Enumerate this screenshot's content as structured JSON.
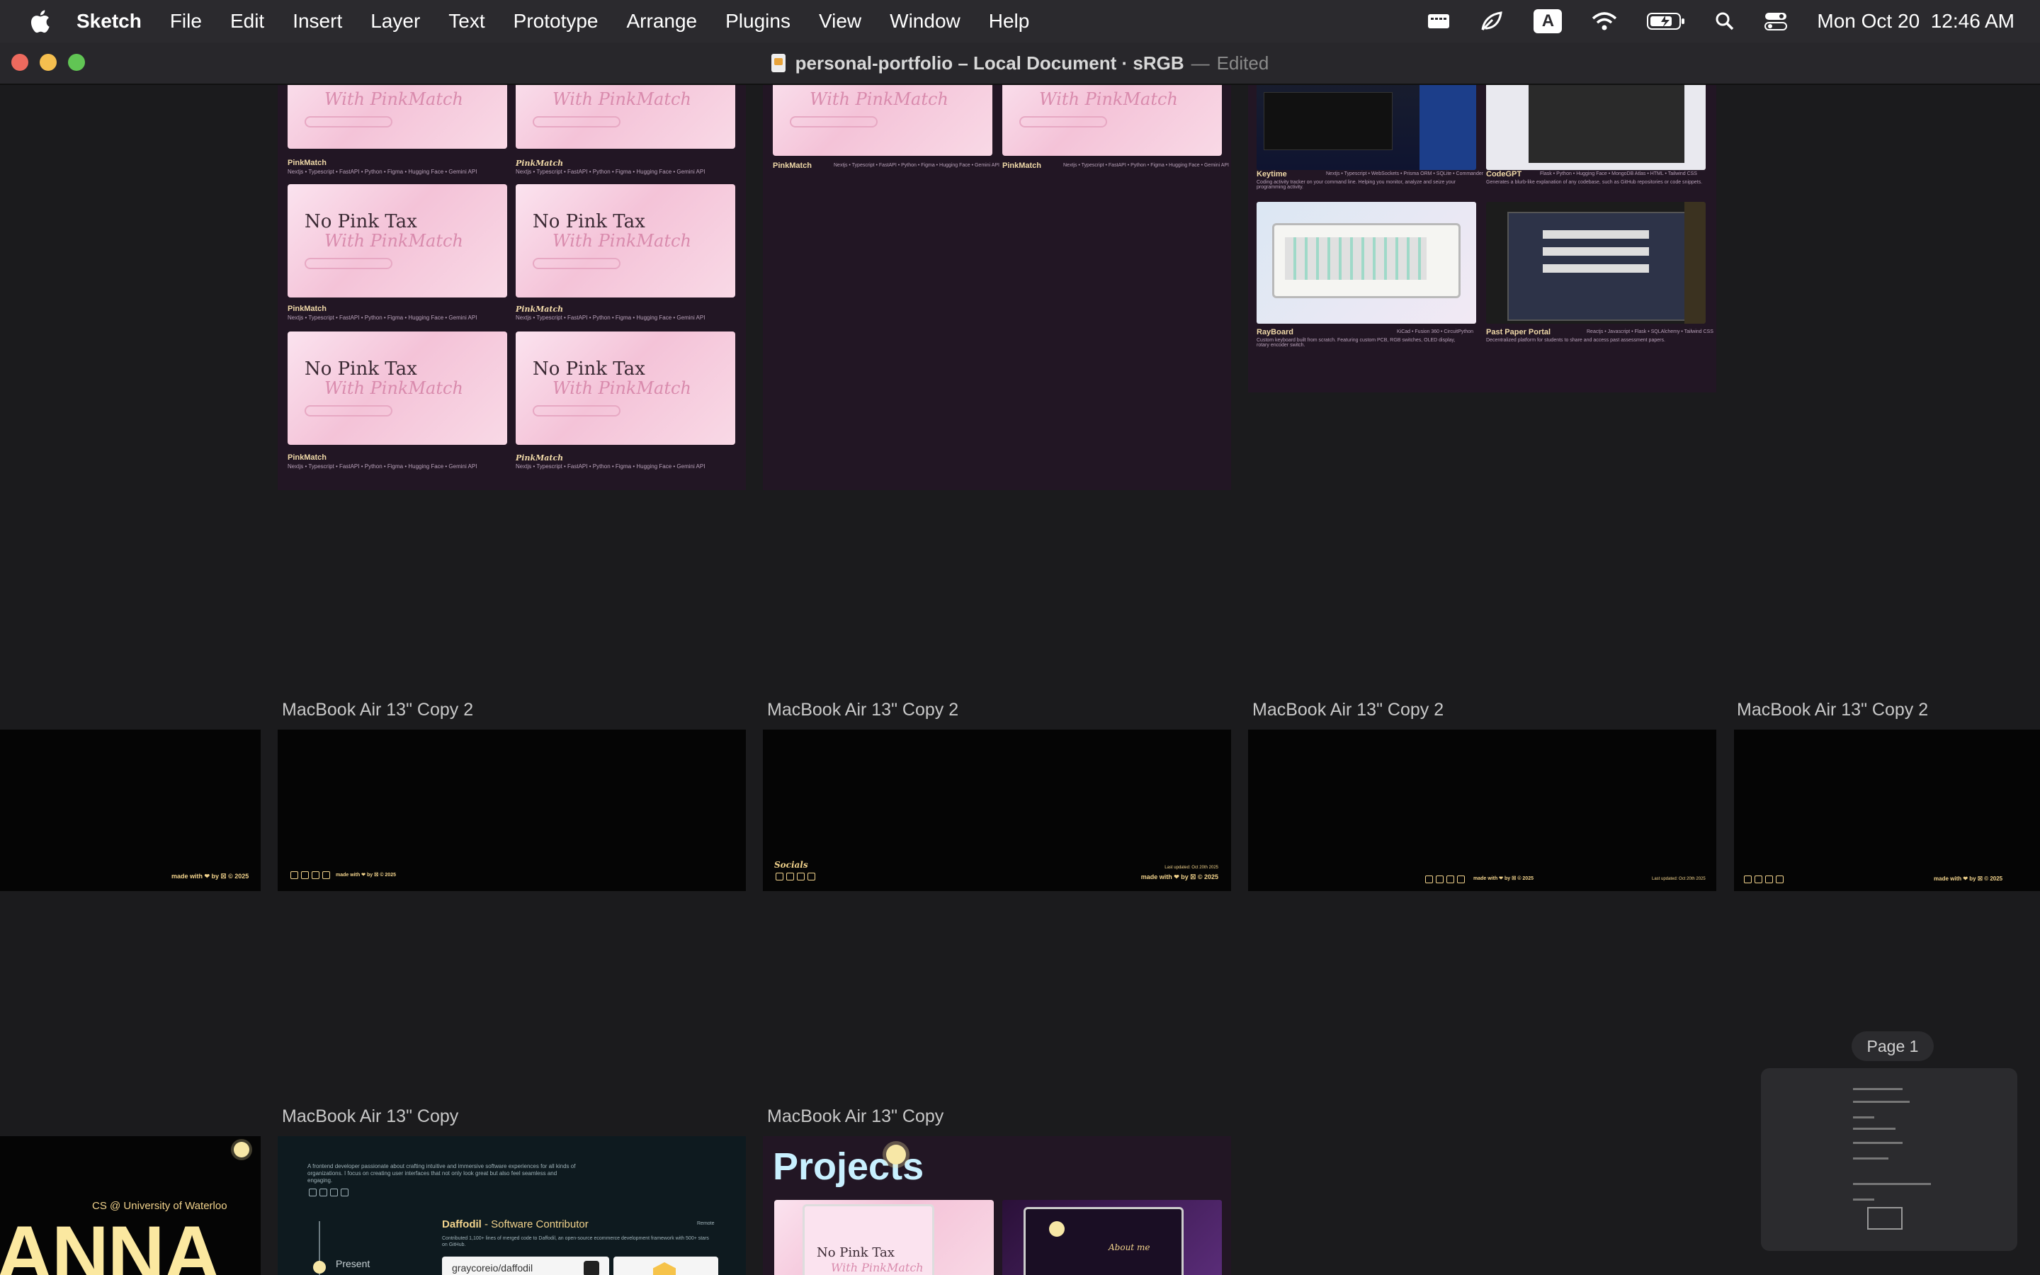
{
  "menubar": {
    "app_name": "Sketch",
    "items": [
      "File",
      "Edit",
      "Insert",
      "Layer",
      "Text",
      "Prototype",
      "Arrange",
      "Plugins",
      "View",
      "Window",
      "Help"
    ],
    "clock": "Mon Oct 20  12:46 AM",
    "input_source": "A"
  },
  "window": {
    "title": "personal-portfolio – Local Document · sRGB",
    "separator": "—",
    "status": "Edited"
  },
  "artboards": {
    "row2_label": "MacBook Air 13\" Copy 2",
    "row3_label": "MacBook Air 13\" Copy"
  },
  "cards": {
    "title_line1": "No Pink Tax",
    "title_line2": "With PinkMatch",
    "caption_title": "PinkMatch",
    "caption_italic": "PinkMatch",
    "caption_stack": "Nextjs • Typescript • FastAPI • Python • Figma • Hugging Face • Gemini API"
  },
  "projects": {
    "keytime": {
      "name": "Keytime",
      "stack": "Nextjs • Typescript • WebSockets • Prisma ORM • SQLite • Commander",
      "desc": "Coding activity tracker on your command line. Helping you monitor, analyze and seize your programming activity."
    },
    "codegpt": {
      "name": "CodeGPT",
      "stack": "Flask • Python • Hugging Face • MongoDB Atlas • HTML • Tailwind CSS",
      "desc": "Generates a blurb-like explanation of any codebase, such as GitHub repositories or code snippets."
    },
    "rayboard": {
      "name": "RayBoard",
      "stack": "KiCad • Fusion 360 • CircuitPython",
      "desc": "Custom keyboard built from scratch. Featuring custom PCB, RGB switches, OLED display, rotary encoder switch."
    },
    "pastpaper": {
      "name": "Past Paper Portal",
      "stack": "Reactjs • Javascript • Flask • SQLAlchemy • Tailwind CSS",
      "desc": "Decentralized platform for students to share and access past assessment papers."
    }
  },
  "footer": {
    "made_with": "made with ❤ by ☒ © 2025",
    "socials": "Socials",
    "last_updated": "Last updated: Oct 20th 2025"
  },
  "hero": {
    "subtitle": "CS @ University of Waterloo",
    "name": "ANNA"
  },
  "experience": {
    "intro": "A frontend developer passionate about crafting intuitive and immersive software experiences for all kinds of organizations. I focus on creating user interfaces that not only look great but also feel seamless and engaging.",
    "company": "Daffodil",
    "role": " - Software Contributor",
    "tag": "Remote",
    "summary": "Contributed 1,100+ lines of merged code to Daffodil, an open-source ecommerce development framework with 500+ stars on GitHub.",
    "repo": "graycoreio/daffodil",
    "timeline": "Present"
  },
  "projects_page": {
    "heading": "Projects",
    "about_me": "About me"
  },
  "navigator": {
    "page_label": "Page 1"
  },
  "colors": {
    "menubar": "#2b2a2e",
    "canvas": "#1b1b1d",
    "artboard_purple": "#221624",
    "artboard_black": "#050505",
    "accent_yellow": "#f2d38c",
    "pink": "#f4c3d8"
  },
  "icons": [
    "apple-icon",
    "display-icon",
    "leaf-icon",
    "input-source-icon",
    "wifi-icon",
    "battery-icon",
    "search-icon",
    "control-center-icon",
    "document-icon",
    "sun-icon",
    "sparkle-icon"
  ]
}
